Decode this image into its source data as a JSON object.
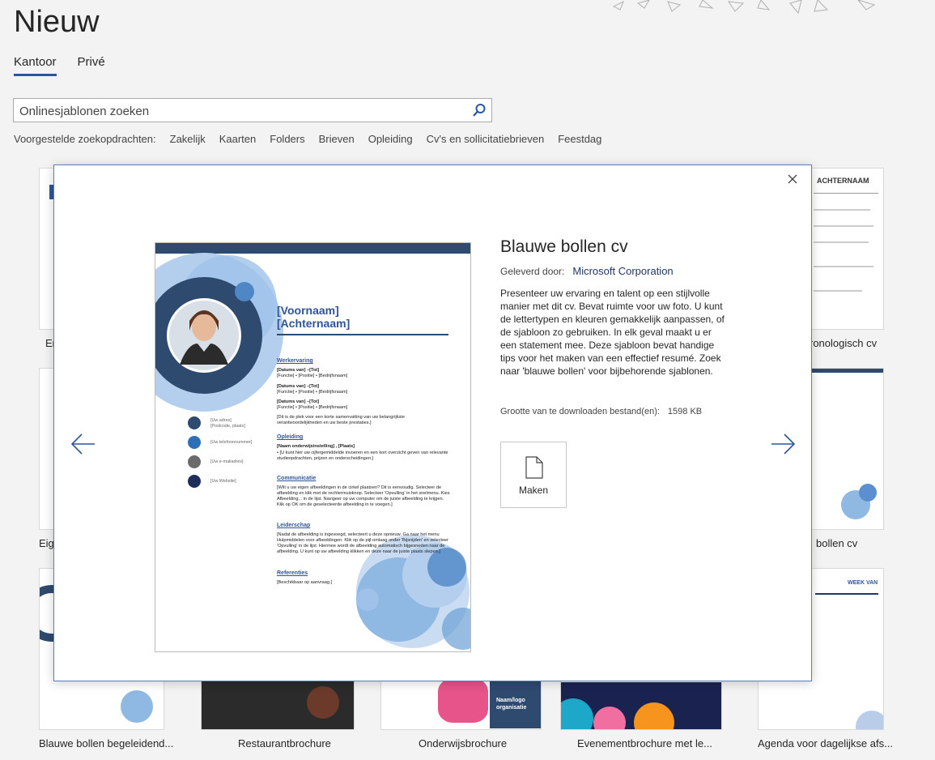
{
  "page": {
    "title": "Nieuw",
    "tabs": [
      "Kantoor",
      "Privé"
    ],
    "search_placeholder": "Onlinesjablonen zoeken",
    "suggest_label": "Voorgestelde zoekopdrachten:",
    "suggestions": [
      "Zakelijk",
      "Kaarten",
      "Folders",
      "Brieven",
      "Opleiding",
      "Cv's en sollicitatiebrieven",
      "Feestdag"
    ]
  },
  "background_captions": {
    "row1_left": "En",
    "row1_right": "ronologisch cv",
    "row2_left": "Eige",
    "row2_right": "bollen cv",
    "bottom": [
      "Blauwe bollen begeleidend...",
      "Restaurantbrochure",
      "Onderwijsbrochure",
      "Evenementbrochure met le...",
      "Agenda voor dagelijkse afs..."
    ]
  },
  "background_thumb_text": {
    "achternaam": "ACHTERNAAM",
    "week_van": "WEEK VAN",
    "naamlogo": "Naam/logo organisatie"
  },
  "modal": {
    "title": "Blauwe bollen cv",
    "provider_label": "Geleverd door:",
    "provider": "Microsoft Corporation",
    "description": "Presenteer uw ervaring en talent op een stijlvolle manier met dit cv. Bevat ruimte voor uw foto. U kunt de lettertypen en kleuren gemakkelijk aanpassen, of de sjabloon zo gebruiken. In elk geval maakt u er een statement mee. Deze sjabloon bevat handige tips voor het maken van een effectief resumé. Zoek naar 'blauwe bollen' voor bijbehorende sjablonen.",
    "size_label": "Grootte van te downloaden bestand(en):",
    "size_value": "1598 KB",
    "create_label": "Maken"
  },
  "preview": {
    "name_line1": "[Voornaam]",
    "name_line2": "[Achternaam]",
    "h_werk": "Werkervaring",
    "werk1a": "[Datums van] –[Tot]",
    "werk1b": "[Functie] • [Positie] • [Bedrijfsnaam]",
    "werk2a": "[Datums van] –[Tot]",
    "werk2b": "[Functie] • [Positie] • [Bedrijfsnaam]",
    "werk3a": "[Datums van] –[Tot]",
    "werk3b": "[Functie] • [Positie] • [Bedrijfsnaam]",
    "werk_note": "[Dit is de plek voor een korte samenvatting van uw belangrijkste verantwoordelijkheden en uw beste prestaties.]",
    "h_opl": "Opleiding",
    "opl1": "[Naam onderwijsinstelling] , [Plaats]",
    "opl2": "• [U kunt hier uw cijfergemiddelde invoeren en een kort overzicht geven van relevante studieopdrachten, prijzen en onderscheidingen.]",
    "h_comm": "Communicatie",
    "comm": "[Wilt u uw eigen afbeeldingen in de cirkel plaatsen? Dit is eenvoudig. Selecteer de afbeelding en klik met de rechtermuisknop. Selecteer 'Opvulling' in het snelmenu. Kies Afbeelding... in de lijst. Navigeer op uw computer om de juiste afbeelding te krijgen. Klik op OK om de geselecteerde afbeelding in te voegen.]",
    "h_leid": "Leiderschap",
    "leid": "[Nadat de afbeelding is ingevoegd, selecteert u deze opnieuw. Ga naar het menu Hulpmiddelen voor afbeeldingen. Klik op de pijl-omlaag onder 'Bijsnijden' en selecteer 'Opvulling' in de lijst. Hiermee wordt de afbeelding automatisch bijgesneden naar de afbeelding. U kunt op uw afbeelding klikken en deze naar de juiste plaats slepen.]",
    "h_ref": "Referenties",
    "ref": "[Beschikbaar op aanvraag.]",
    "side_adres1": "[Uw adres]",
    "side_adres2": "[Postcode, plaats]",
    "side_tel": "[Uw telefoonnummer]",
    "side_mail": "[Uw e-mailadres]",
    "side_web": "[Uw Website]"
  },
  "colors": {
    "accent": "#2b579a",
    "bubble_dark": "#2e4a6e",
    "bubble_light": "#8fb8e3",
    "link": "#1f3864"
  },
  "icons": {
    "search": "search-icon",
    "close": "close-icon",
    "prev": "arrow-left-icon",
    "next": "arrow-right-icon",
    "doc": "document-icon"
  }
}
